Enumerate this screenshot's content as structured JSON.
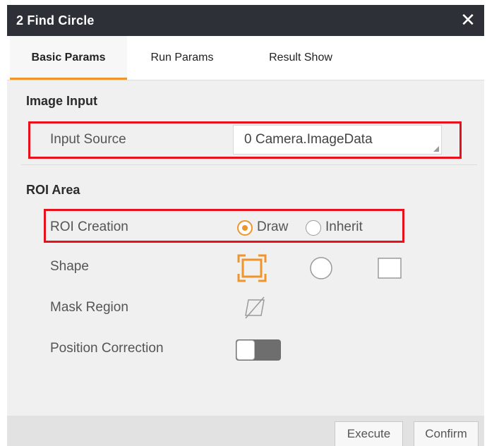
{
  "window": {
    "title": "2 Find Circle",
    "close_symbol": "✕"
  },
  "tabs": [
    {
      "label": "Basic Params",
      "active": true
    },
    {
      "label": "Run Params",
      "active": false
    },
    {
      "label": "Result Show",
      "active": false
    }
  ],
  "image_input": {
    "section_title": "Image Input",
    "input_source_label": "Input Source",
    "input_source_value": "0 Camera.ImageData"
  },
  "roi_area": {
    "section_title": "ROI Area",
    "roi_creation_label": "ROI Creation",
    "roi_creation_options": [
      {
        "label": "Draw",
        "selected": true
      },
      {
        "label": "Inherit",
        "selected": false
      }
    ],
    "shape_label": "Shape",
    "shapes": [
      {
        "icon": "full-image-icon",
        "selected": true
      },
      {
        "icon": "circle-icon",
        "selected": false
      },
      {
        "icon": "rectangle-icon",
        "selected": false
      }
    ],
    "mask_region_label": "Mask Region",
    "mask_icon": "mask-region-icon",
    "position_correction_label": "Position Correction",
    "position_correction_enabled": false
  },
  "footer": {
    "execute_label": "Execute",
    "confirm_label": "Confirm"
  },
  "colors": {
    "accent": "#f0952c",
    "highlight": "#e8101a",
    "titlebar": "#2d3036"
  }
}
